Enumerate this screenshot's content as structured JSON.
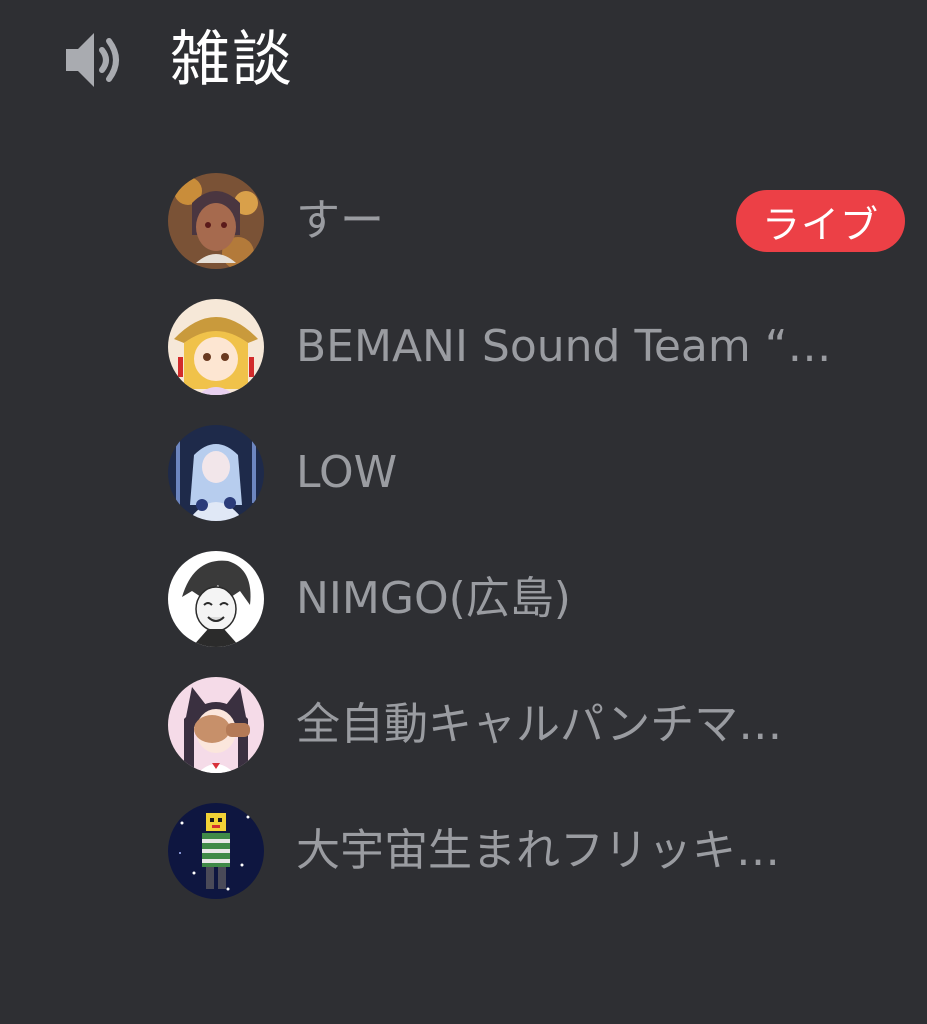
{
  "channel": {
    "name": "雑談",
    "icon": "speaker-icon"
  },
  "users": [
    {
      "name": "すー",
      "badge": "ライブ",
      "avatar": "avatar-brown-haired-girl",
      "colors": [
        "#6a4a3a",
        "#c8915a",
        "#3c2a25"
      ]
    },
    {
      "name": "BEMANI Sound Team “…",
      "avatar": "avatar-blonde-girl-hat",
      "colors": [
        "#e8c24a",
        "#d08a2a",
        "#fbe9d2"
      ]
    },
    {
      "name": "LOW",
      "avatar": "avatar-blue-haired-girl",
      "colors": [
        "#2e4c8a",
        "#aac6ee",
        "#1a2440"
      ]
    },
    {
      "name": "NIMGO(広島)",
      "avatar": "avatar-monochrome-boy",
      "colors": [
        "#ffffff",
        "#2b2b2b",
        "#8a8a8a"
      ]
    },
    {
      "name": "全自動キャルパンチマ…",
      "avatar": "avatar-cat-ear-girl",
      "colors": [
        "#f3d9e6",
        "#3a3040",
        "#c7906a"
      ]
    },
    {
      "name": "大宇宙生まれフリッキ…",
      "avatar": "avatar-pixel-space",
      "colors": [
        "#101a44",
        "#2c4a8a",
        "#3a8a4a"
      ]
    }
  ]
}
